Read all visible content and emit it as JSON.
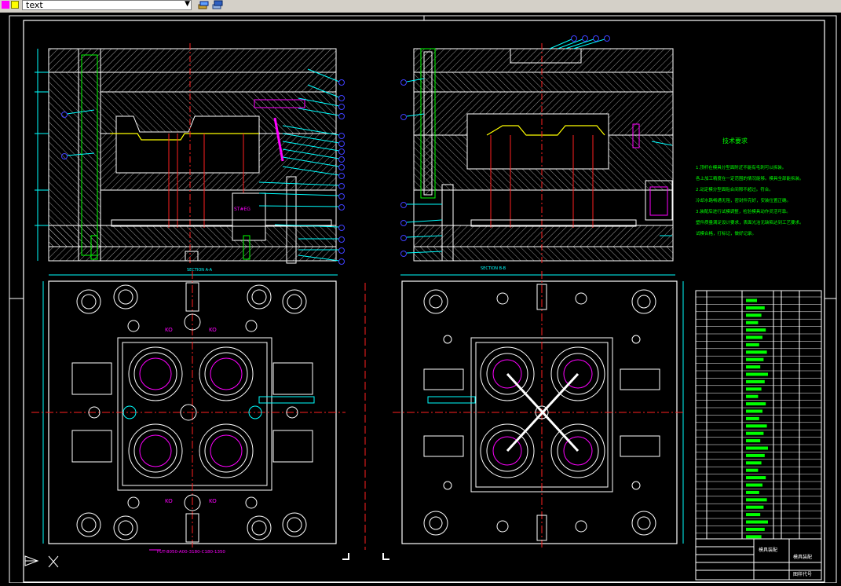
{
  "toolbar": {
    "layer_name": "text",
    "icons": [
      "layer-manager-icon",
      "layer-state-icon"
    ],
    "colors": {
      "magenta": "#ff00ff",
      "yellow": "#ffff00",
      "face": "#d4d0c8"
    }
  },
  "drawing": {
    "section_a_label": "SECTION A-A",
    "section_b_label": "SECTION B-B",
    "part_label": "ST#EG",
    "bottom_note": "FUT-8050-A00-3180-C180-1350",
    "tech_title": "技术要求",
    "tech_lines": [
      "1.顶杆在模具分型面附近不能有毛刺可以拆装。",
      "各上加工精度在一定范围的情况能够。模具全部能拆装。",
      "2.动定模分型面贴合间隙不超过。符合。",
      "冷却水路畅通无阻，密封件完好，安装位置正确。",
      "3.装配后进行试模调整，检验模具动作灵活可靠。",
      "塑件质量满足设计要求，表面光洁无缺陷达到工艺要求。",
      "试模合格，打标记，做好记录。"
    ],
    "key_label": "KO",
    "title_block": {
      "cell_1": "模具装配",
      "cell_2": "模具装配",
      "cell_3": "图样代号"
    }
  },
  "colors": {
    "background": "#000000",
    "line_white": "#ffffff",
    "line_red": "#ff2020",
    "line_green": "#00ff00",
    "line_cyan": "#00ffff",
    "line_magenta": "#ff00ff",
    "line_yellow": "#ffff00",
    "line_blue": "#4040ff"
  }
}
